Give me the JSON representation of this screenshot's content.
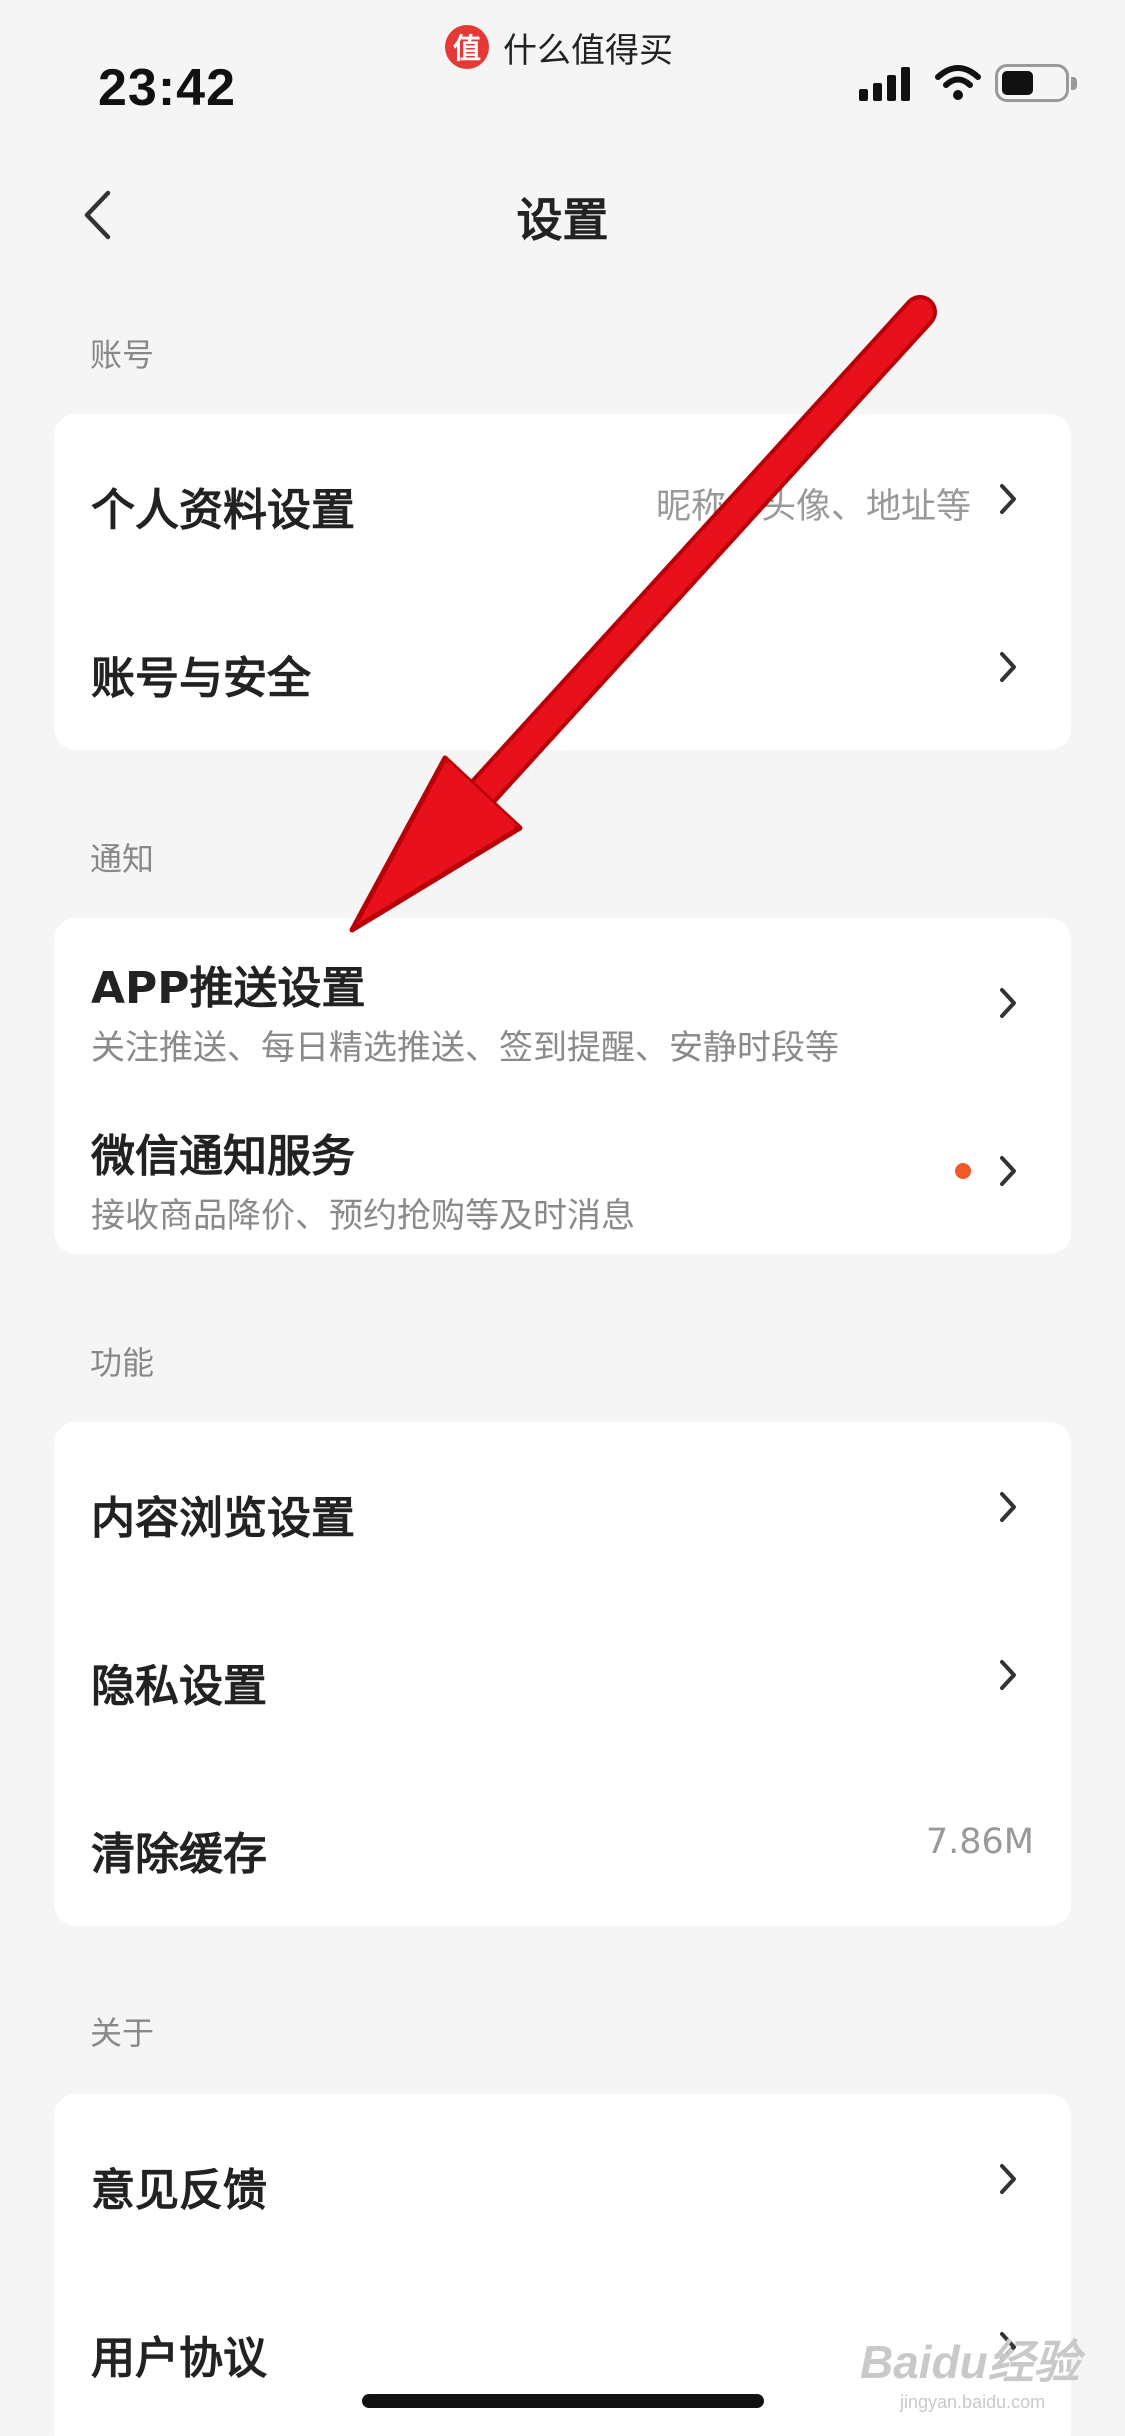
{
  "status_bar": {
    "time": "23:42",
    "source_app_logo": "值",
    "source_app_name": "什么值得买",
    "icons": [
      "cellular-signal-icon",
      "wifi-icon",
      "battery-icon"
    ],
    "battery_level": 0.5
  },
  "nav": {
    "title": "设置",
    "back_icon": "chevron-left-icon"
  },
  "sections": {
    "account": {
      "label": "账号",
      "items": [
        {
          "title": "个人资料设置",
          "value": "昵称、头像、地址等"
        },
        {
          "title": "账号与安全"
        }
      ]
    },
    "notification": {
      "label": "通知",
      "items": [
        {
          "title": "APP推送设置",
          "subtitle": "关注推送、每日精选推送、签到提醒、安静时段等"
        },
        {
          "title": "微信通知服务",
          "subtitle": "接收商品降价、预约抢购等及时消息",
          "has_badge": true
        }
      ]
    },
    "features": {
      "label": "功能",
      "items": [
        {
          "title": "内容浏览设置"
        },
        {
          "title": "隐私设置"
        },
        {
          "title": "清除缓存",
          "value": "7.86M"
        }
      ]
    },
    "about": {
      "label": "关于",
      "items": [
        {
          "title": "意见反馈"
        },
        {
          "title": "用户协议"
        }
      ]
    }
  },
  "watermark": {
    "main": "Baidu经验",
    "sub": "jingyan.baidu.com"
  },
  "colors": {
    "background": "#f5f5f5",
    "card": "#ffffff",
    "badge": "#f05a28",
    "annotation_arrow": "#e8101a"
  }
}
